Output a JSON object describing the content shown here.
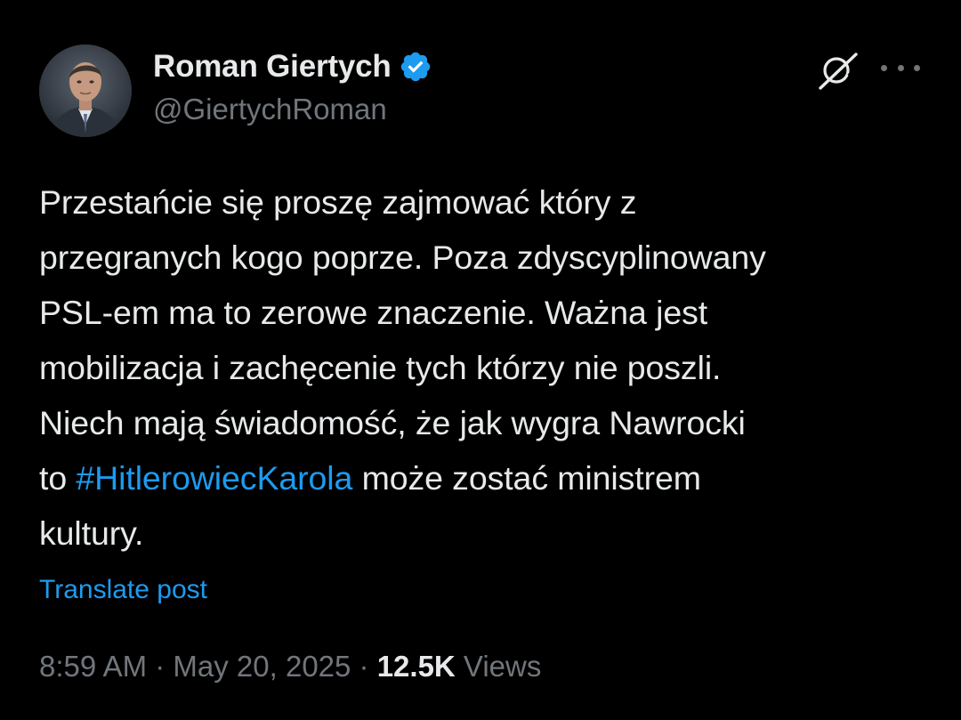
{
  "author": {
    "display_name": "Roman Giertych",
    "handle": "@GiertychRoman",
    "verified_icon": "verified-badge-icon",
    "verified_color": "#1d9bf0"
  },
  "actions": {
    "grok_icon": "grok-icon",
    "more_icon": "more-options-icon"
  },
  "post": {
    "lines": [
      "Przestańcie się proszę zajmować który z",
      "przegranych kogo poprze. Poza zdyscyplinowany",
      "PSL-em ma to zerowe znaczenie. Ważna jest",
      "mobilizacja i zachęcenie tych którzy nie poszli.",
      "Niech mają świadomość, że jak wygra Nawrocki"
    ],
    "line6_prefix": "to ",
    "hashtag": "#HitlerowiecKarola",
    "line6_suffix": " może zostać ministrem",
    "line7": "kultury."
  },
  "translate_label": "Translate post",
  "meta": {
    "time": "8:59 AM",
    "separator": " · ",
    "date": "May 20, 2025",
    "views_count": "12.5K",
    "views_label": " Views"
  },
  "colors": {
    "background": "#000000",
    "text": "#e7e9ea",
    "secondary": "#71767b",
    "link": "#1d9bf0"
  }
}
